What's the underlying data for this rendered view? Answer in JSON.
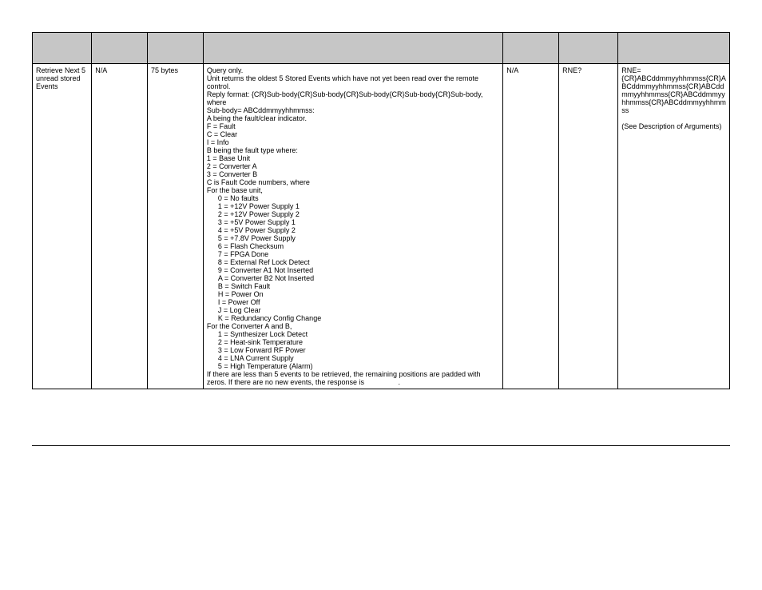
{
  "table": {
    "row": {
      "param": "Retrieve Next 5 unread stored Events",
      "cmd": "N/A",
      "args": "75 bytes",
      "desc": {
        "l0": "Query only.",
        "l1": "Unit returns the oldest 5 Stored Events which have not yet been read over the remote control.",
        "l2": "Reply format: {CR}Sub-body{CR}Sub-body{CR}Sub-body{CR}Sub-body{CR}Sub-body, where",
        "l3": "Sub-body= ABCddmmyyhhmmss:",
        "l4": "A being the fault/clear indicator.",
        "l5": "F = Fault",
        "l6": "C = Clear",
        "l7": "I = Info",
        "l8": "B being the fault type where:",
        "l9": "1 = Base Unit",
        "l10": "2 = Converter A",
        "l11": "3 = Converter B",
        "l12": "C is Fault Code numbers, where",
        "l13": "For the base unit,",
        "i0": "0 = No faults",
        "i1": "1 = +12V Power Supply 1",
        "i2": "2 = +12V Power Supply 2",
        "i3": "3 = +5V Power Supply 1",
        "i4": "4 = +5V Power Supply 2",
        "i5": "5 = +7.8V Power Supply",
        "i6": "6 = Flash Checksum",
        "i7": "7 = FPGA Done",
        "i8": "8 = External Ref Lock Detect",
        "i9": "9 = Converter A1 Not Inserted",
        "i10": "A = Converter B2 Not Inserted",
        "i11": "B = Switch Fault",
        "i12": "H = Power On",
        "i13": "I = Power Off",
        "i14": "J = Log Clear",
        "i15": "K = Redundancy Config Change",
        "l14": "For the Converter A and B,",
        "j0": "1 = Synthesizer Lock Detect",
        "j1": "2 = Heat-sink Temperature",
        "j2": "3 = Low Forward RF Power",
        "j3": "4 = LNA Current Supply",
        "j4": "5 = High Temperature (Alarm)",
        "l15": "If there are less than 5 events to be retrieved, the remaining positions are padded with zeros. If there are no new events, the response is                 ."
      },
      "resp": "N/A",
      "query": "RNE?",
      "rformat": {
        "l0": "RNE={CR}ABCddmmyyhhmmss{CR}ABCddmmyyhhmmss{CR}ABCddmmyyhhmmss{CR}ABCddmmyyhhmmss{CR}ABCddmmyyhhmmss",
        "l1": "(See Description of Arguments)"
      }
    }
  }
}
